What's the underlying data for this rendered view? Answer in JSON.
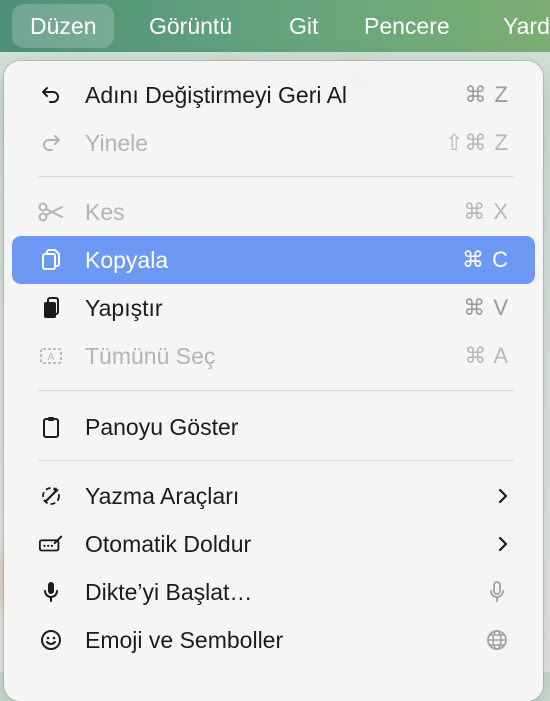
{
  "menubar": {
    "items": [
      "Düzen",
      "Görüntü",
      "Git",
      "Pencere",
      "Yardım"
    ]
  },
  "menu": {
    "items": [
      {
        "label": "Adını Değiştirmeyi Geri Al",
        "shortcut": "⌘ Z",
        "icon": "undo-icon",
        "enabled": true
      },
      {
        "label": "Yinele",
        "shortcut": "⇧⌘ Z",
        "icon": "redo-icon",
        "enabled": false
      },
      {
        "label": "Kes",
        "shortcut": "⌘ X",
        "icon": "scissors-icon",
        "enabled": false
      },
      {
        "label": "Kopyala",
        "shortcut": "⌘ C",
        "icon": "copy-icon",
        "enabled": true,
        "highlighted": true
      },
      {
        "label": "Yapıştır",
        "shortcut": "⌘ V",
        "icon": "paste-icon",
        "enabled": true
      },
      {
        "label": "Tümünü Seç",
        "shortcut": "⌘ A",
        "icon": "select-all-icon",
        "enabled": false
      },
      {
        "label": "Panoyu Göster",
        "icon": "clipboard-icon",
        "enabled": true
      },
      {
        "label": "Yazma Araçları",
        "icon": "writing-tools-icon",
        "submenu": true,
        "enabled": true
      },
      {
        "label": "Otomatik Doldur",
        "icon": "autofill-icon",
        "submenu": true,
        "enabled": true
      },
      {
        "label": "Dikte’yi Başlat…",
        "icon": "microphone-icon",
        "trailing_icon": "microphone-icon",
        "enabled": true
      },
      {
        "label": "Emoji ve Semboller",
        "icon": "emoji-icon",
        "trailing_icon": "globe-icon",
        "enabled": true
      }
    ]
  },
  "colors": {
    "highlight": "#6d99f4",
    "menubar_gradient_start": "#4e8f78",
    "menubar_gradient_end": "#7cae74"
  }
}
